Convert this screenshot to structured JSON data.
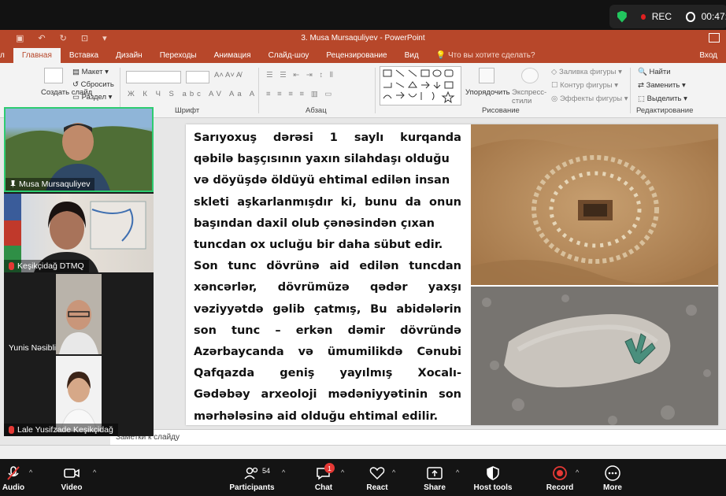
{
  "zoom_top": {
    "rec_label": "REC",
    "timer": "00:47:"
  },
  "ppt": {
    "window_title": "3. Musa Mursaquliyev - PowerPoint",
    "tabs": [
      {
        "label": "л"
      },
      {
        "label": "Главная"
      },
      {
        "label": "Вставка"
      },
      {
        "label": "Дизайн"
      },
      {
        "label": "Переходы"
      },
      {
        "label": "Анимация"
      },
      {
        "label": "Слайд-шоу"
      },
      {
        "label": "Рецензирование"
      },
      {
        "label": "Вид"
      },
      {
        "label": "Что вы хотите сделать?"
      }
    ],
    "login_label": "Вход",
    "ribbon": {
      "create_slide": "Создать слайд",
      "layout": "Макет",
      "reset": "Сбросить",
      "section": "Раздел",
      "group_font": "Шрифт",
      "group_paragraph": "Абзац",
      "group_drawing": "Рисование",
      "group_editing": "Редактирование",
      "arrange": "Упорядочить",
      "quick_styles": "Экспресс-стили",
      "shape_fill": "Заливка фигуры",
      "shape_outline": "Контур фигуры",
      "shape_effects": "Эффекты фигуры",
      "find": "Найти",
      "replace": "Заменить",
      "select": "Выделить"
    },
    "slide": {
      "text_lines": [
        [
          "Sarıyoxuş",
          "dərəsi",
          "1",
          "saylı",
          "kurqanda"
        ],
        [
          "qəbilə başçısının yaxın silahdaşı olduğu"
        ],
        [
          "və döyüşdə öldüyü ehtimal edilən insan"
        ],
        [
          "skleti",
          "aşkarlanmışdır",
          "ki,",
          "bunu",
          "da",
          "onun"
        ],
        [
          "başından daxil olub çənəsindən çıxan"
        ],
        [
          "tuncdan ox ucluğu bir daha sübut edir."
        ],
        [
          "Son",
          "tunc",
          "dövrünə",
          "aid",
          "edilən",
          "tuncdan"
        ],
        [
          "xəncərlər,",
          "dövrümüzə",
          "qədər",
          "yaxşı"
        ],
        [
          "vəziyyətdə",
          "gəlib",
          "çatmış,",
          "Bu",
          "abidələrin"
        ],
        [
          "son",
          "tunc",
          "–",
          "erkən",
          "dəmir",
          "dövründə"
        ],
        [
          "Azərbaycanda",
          "və",
          "ümumilikdə",
          "Cənubi"
        ],
        [
          "Qafqazda",
          "geniş",
          "yayılmış",
          "Xocalı-"
        ],
        [
          "Gədəbəy",
          "arxeoloji",
          "mədəniyyətinin",
          "son"
        ],
        [
          "mərhələsinə aid olduğu ehtimal edilir."
        ]
      ]
    },
    "notes_placeholder": "Заметки к слайду"
  },
  "gallery": [
    {
      "name": "Musa Mursaquliyev",
      "pinned": true
    },
    {
      "name": "Keşikçidağ DTMQ",
      "muted": true
    },
    {
      "name": "Yunis Nəsibli"
    },
    {
      "name": "Lale Yusifzade Keşikçidağ",
      "muted": true
    }
  ],
  "toolbar": {
    "audio": "Audio",
    "video": "Video",
    "participants": "Participants",
    "participants_count": "54",
    "chat": "Chat",
    "chat_badge": "1",
    "react": "React",
    "share": "Share",
    "host_tools": "Host tools",
    "record": "Record",
    "more": "More"
  }
}
